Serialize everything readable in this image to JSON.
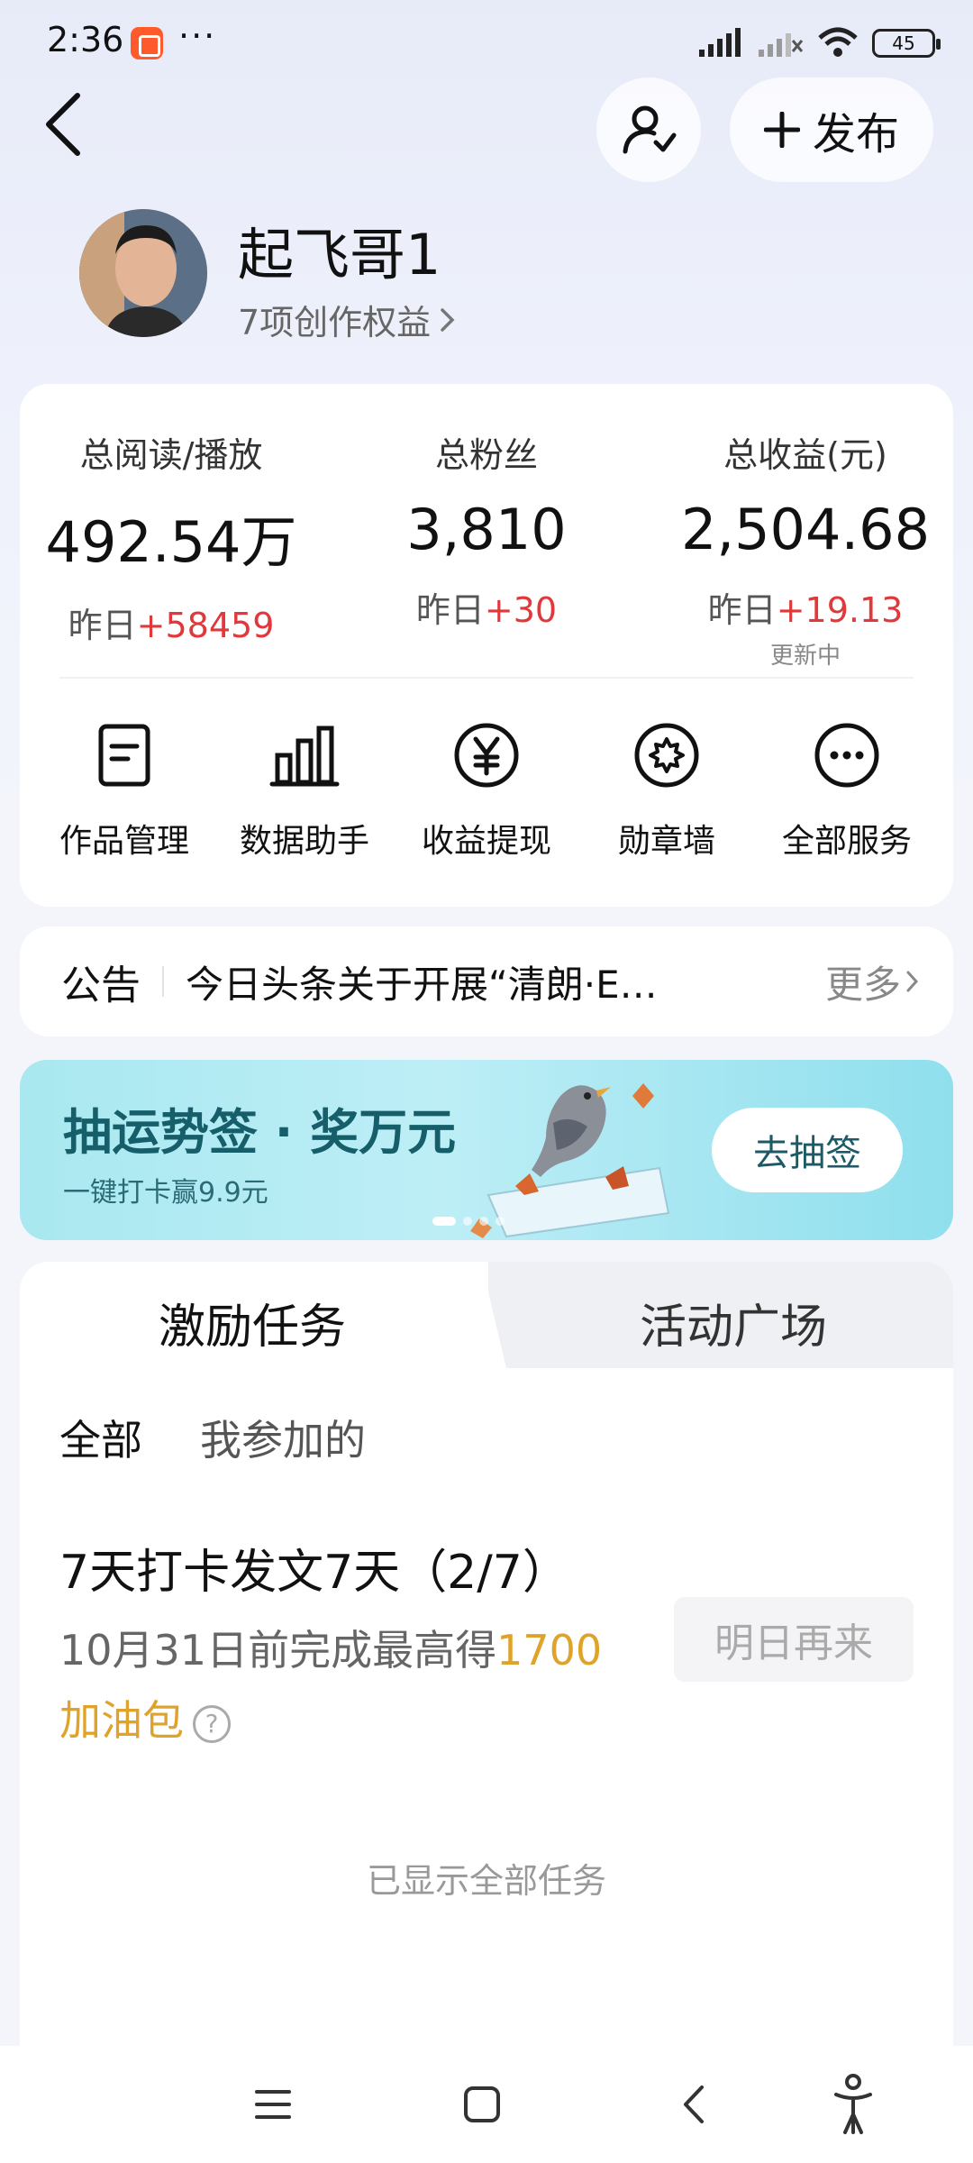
{
  "status_bar": {
    "time": "2:36",
    "dots": "···",
    "battery": "45"
  },
  "header": {
    "publish_label": "发布"
  },
  "profile": {
    "name": "起飞哥1",
    "rights": "7项创作权益"
  },
  "stats": [
    {
      "label": "总阅读/播放",
      "value": "492.54万",
      "yesterday_prefix": "昨日",
      "yesterday_delta": "+58459",
      "note": ""
    },
    {
      "label": "总粉丝",
      "value": "3,810",
      "yesterday_prefix": "昨日",
      "yesterday_delta": "+30",
      "note": ""
    },
    {
      "label": "总收益(元)",
      "value": "2,504.68",
      "yesterday_prefix": "昨日",
      "yesterday_delta": "+19.13",
      "note": "更新中"
    }
  ],
  "tools": [
    {
      "label": "作品管理",
      "icon": "document-icon"
    },
    {
      "label": "数据助手",
      "icon": "bar-chart-icon"
    },
    {
      "label": "收益提现",
      "icon": "yuan-icon"
    },
    {
      "label": "勋章墙",
      "icon": "medal-icon"
    },
    {
      "label": "全部服务",
      "icon": "more-icon"
    }
  ],
  "notice": {
    "title": "公告",
    "text": "今日头条关于开展“清朗·E…",
    "more": "更多"
  },
  "banner": {
    "title": "抽运势签 · 奖万元",
    "subtitle": "一键打卡赢9.9元",
    "button": "去抽签"
  },
  "tasks": {
    "tabs": [
      "激励任务",
      "活动广场"
    ],
    "filters": [
      "全部",
      "我参加的"
    ],
    "item": {
      "title": "7天打卡发文7天（2/7）",
      "desc_prefix": "10月31日前完成最高得",
      "desc_highlight_amount": "1700",
      "desc_highlight_unit": "加油包",
      "button": "明日再来"
    },
    "footer": "已显示全部任务"
  },
  "colors": {
    "positive_delta": "#e0383b",
    "highlight": "#e0a32a",
    "banner_text": "#155e6a"
  }
}
